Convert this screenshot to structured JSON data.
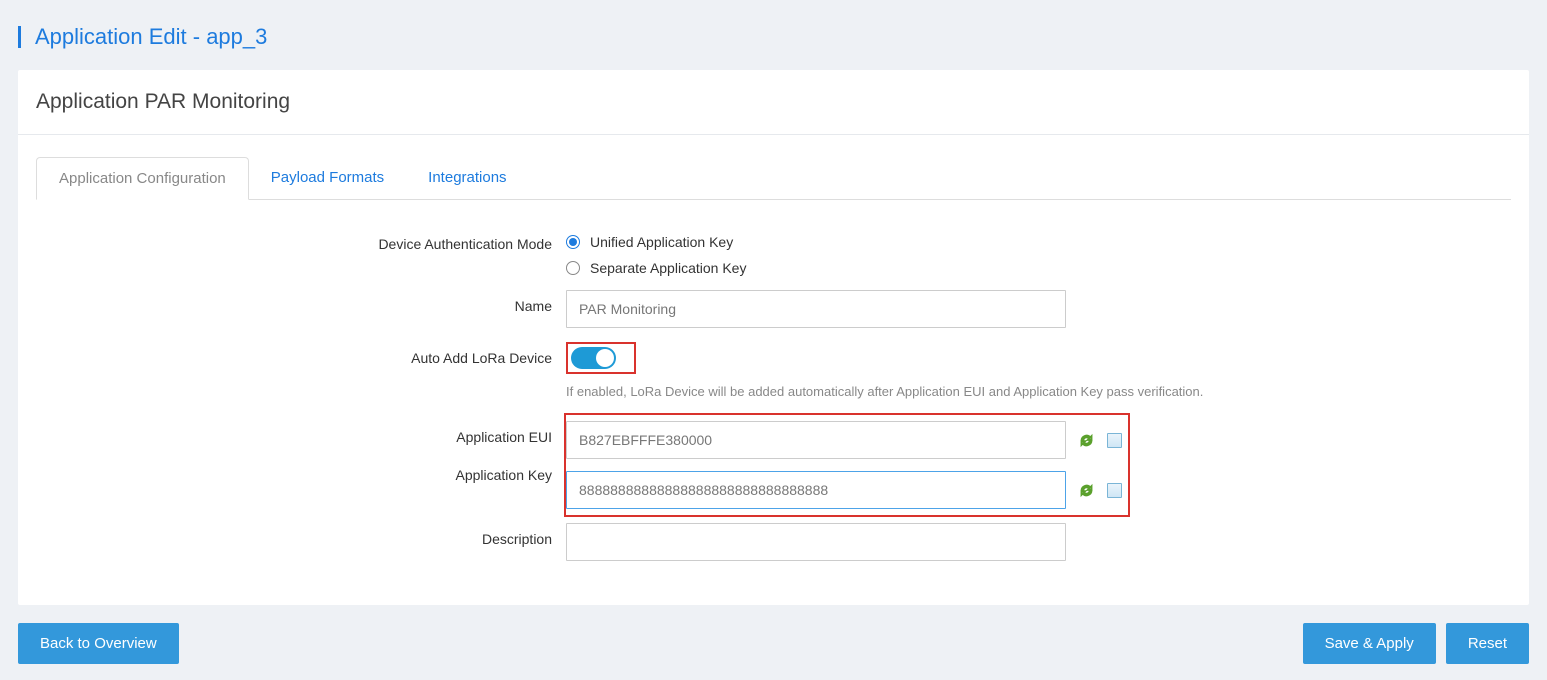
{
  "page_title": "Application Edit - app_3",
  "panel_title": "Application PAR Monitoring",
  "tabs": [
    {
      "label": "Application Configuration",
      "active": true
    },
    {
      "label": "Payload Formats",
      "active": false
    },
    {
      "label": "Integrations",
      "active": false
    }
  ],
  "form": {
    "auth_mode_label": "Device Authentication Mode",
    "auth_mode_options": {
      "unified": "Unified Application Key",
      "separate": "Separate Application Key"
    },
    "auth_mode_selected": "unified",
    "name_label": "Name",
    "name_value": "PAR Monitoring",
    "auto_add_label": "Auto Add LoRa Device",
    "auto_add_enabled": true,
    "auto_add_hint": "If enabled, LoRa Device will be added automatically after Application EUI and Application Key pass verification.",
    "app_eui_label": "Application EUI",
    "app_eui_value": "B827EBFFFE380000",
    "app_key_label": "Application Key",
    "app_key_value": "88888888888888888888888888888888",
    "description_label": "Description",
    "description_value": ""
  },
  "buttons": {
    "back": "Back to Overview",
    "save": "Save & Apply",
    "reset": "Reset"
  }
}
